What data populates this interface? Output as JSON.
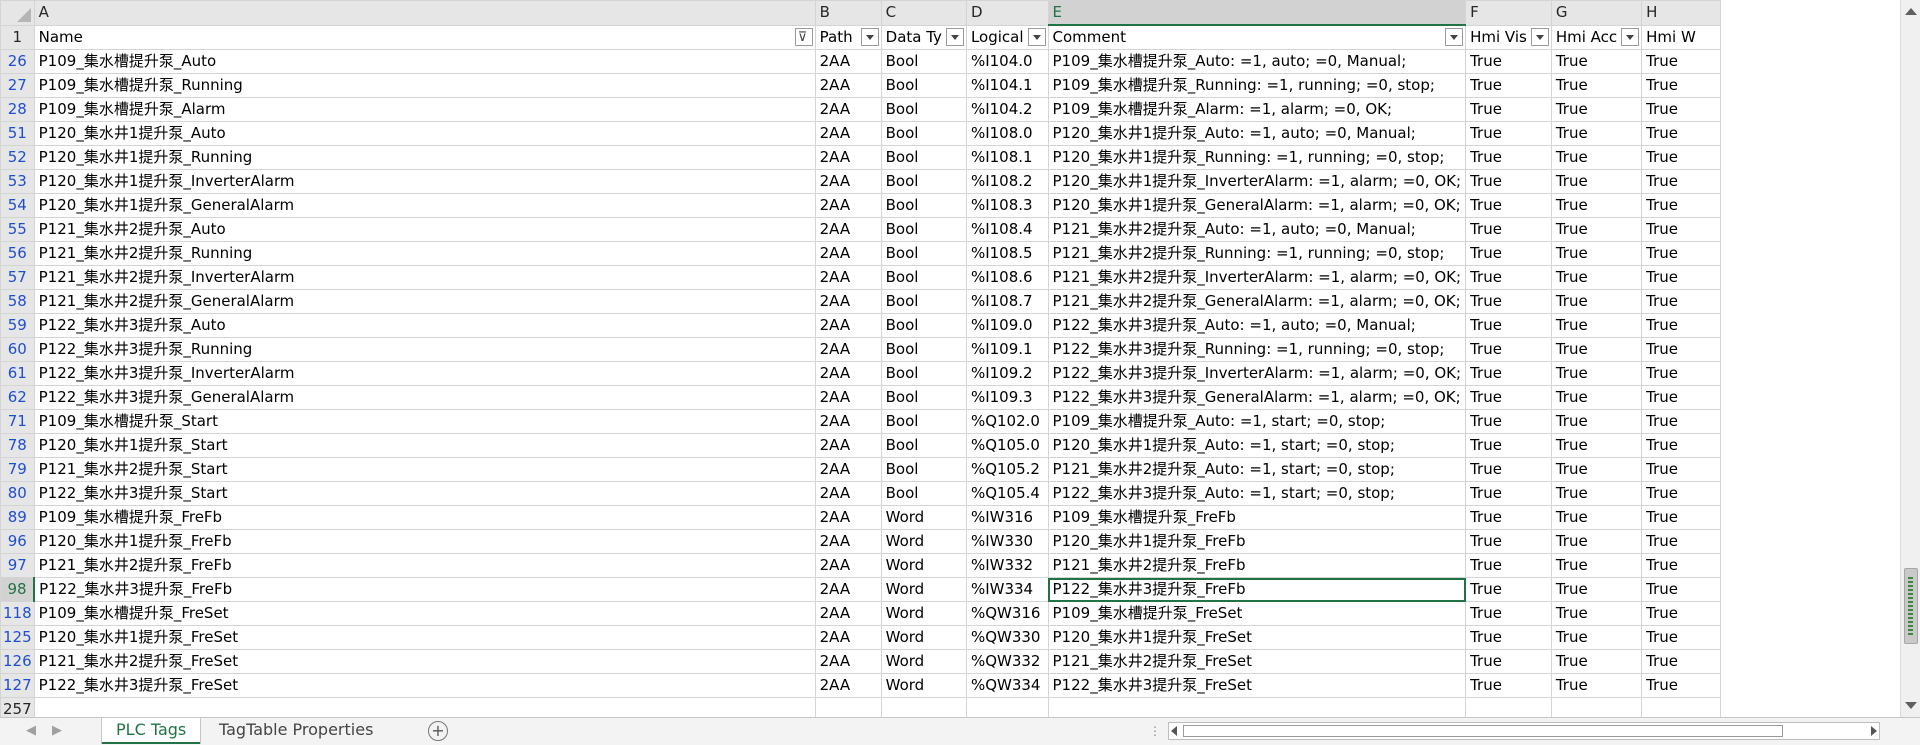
{
  "sheet": {
    "columns": [
      "A",
      "B",
      "C",
      "D",
      "E",
      "F",
      "G",
      "H"
    ],
    "header_row_number": "1",
    "headers": [
      "Name",
      "Path",
      "Data Ty",
      "Logical",
      "Comment",
      "Hmi Vis",
      "Hmi Acc",
      "Hmi W"
    ],
    "rows": [
      {
        "n": "26",
        "cells": [
          "P109_集水槽提升泵_Auto",
          "2AA",
          "Bool",
          "%I104.0",
          "P109_集水槽提升泵_Auto: =1, auto; =0, Manual;",
          "True",
          "True",
          "True"
        ]
      },
      {
        "n": "27",
        "cells": [
          "P109_集水槽提升泵_Running",
          "2AA",
          "Bool",
          "%I104.1",
          "P109_集水槽提升泵_Running: =1, running; =0, stop;",
          "True",
          "True",
          "True"
        ]
      },
      {
        "n": "28",
        "cells": [
          "P109_集水槽提升泵_Alarm",
          "2AA",
          "Bool",
          "%I104.2",
          "P109_集水槽提升泵_Alarm: =1, alarm; =0, OK;",
          "True",
          "True",
          "True"
        ]
      },
      {
        "n": "51",
        "cells": [
          "P120_集水井1提升泵_Auto",
          "2AA",
          "Bool",
          "%I108.0",
          "P120_集水井1提升泵_Auto: =1, auto; =0, Manual;",
          "True",
          "True",
          "True"
        ]
      },
      {
        "n": "52",
        "cells": [
          "P120_集水井1提升泵_Running",
          "2AA",
          "Bool",
          "%I108.1",
          "P120_集水井1提升泵_Running: =1, running; =0, stop;",
          "True",
          "True",
          "True"
        ]
      },
      {
        "n": "53",
        "cells": [
          "P120_集水井1提升泵_InverterAlarm",
          "2AA",
          "Bool",
          "%I108.2",
          "P120_集水井1提升泵_InverterAlarm: =1, alarm; =0, OK;",
          "True",
          "True",
          "True"
        ]
      },
      {
        "n": "54",
        "cells": [
          "P120_集水井1提升泵_GeneralAlarm",
          "2AA",
          "Bool",
          "%I108.3",
          "P120_集水井1提升泵_GeneralAlarm: =1, alarm; =0, OK;",
          "True",
          "True",
          "True"
        ]
      },
      {
        "n": "55",
        "cells": [
          "P121_集水井2提升泵_Auto",
          "2AA",
          "Bool",
          "%I108.4",
          "P121_集水井2提升泵_Auto: =1, auto; =0, Manual;",
          "True",
          "True",
          "True"
        ]
      },
      {
        "n": "56",
        "cells": [
          "P121_集水井2提升泵_Running",
          "2AA",
          "Bool",
          "%I108.5",
          "P121_集水井2提升泵_Running: =1, running; =0, stop;",
          "True",
          "True",
          "True"
        ]
      },
      {
        "n": "57",
        "cells": [
          "P121_集水井2提升泵_InverterAlarm",
          "2AA",
          "Bool",
          "%I108.6",
          "P121_集水井2提升泵_InverterAlarm: =1, alarm; =0, OK;",
          "True",
          "True",
          "True"
        ]
      },
      {
        "n": "58",
        "cells": [
          "P121_集水井2提升泵_GeneralAlarm",
          "2AA",
          "Bool",
          "%I108.7",
          "P121_集水井2提升泵_GeneralAlarm: =1, alarm; =0, OK;",
          "True",
          "True",
          "True"
        ]
      },
      {
        "n": "59",
        "cells": [
          "P122_集水井3提升泵_Auto",
          "2AA",
          "Bool",
          "%I109.0",
          "P122_集水井3提升泵_Auto: =1, auto; =0, Manual;",
          "True",
          "True",
          "True"
        ]
      },
      {
        "n": "60",
        "cells": [
          "P122_集水井3提升泵_Running",
          "2AA",
          "Bool",
          "%I109.1",
          "P122_集水井3提升泵_Running: =1, running; =0, stop;",
          "True",
          "True",
          "True"
        ]
      },
      {
        "n": "61",
        "cells": [
          "P122_集水井3提升泵_InverterAlarm",
          "2AA",
          "Bool",
          "%I109.2",
          "P122_集水井3提升泵_InverterAlarm: =1, alarm; =0, OK;",
          "True",
          "True",
          "True"
        ]
      },
      {
        "n": "62",
        "cells": [
          "P122_集水井3提升泵_GeneralAlarm",
          "2AA",
          "Bool",
          "%I109.3",
          "P122_集水井3提升泵_GeneralAlarm: =1, alarm; =0, OK;",
          "True",
          "True",
          "True"
        ]
      },
      {
        "n": "71",
        "cells": [
          "P109_集水槽提升泵_Start",
          "2AA",
          "Bool",
          "%Q102.0",
          "P109_集水槽提升泵_Auto: =1, start; =0, stop;",
          "True",
          "True",
          "True"
        ]
      },
      {
        "n": "78",
        "cells": [
          "P120_集水井1提升泵_Start",
          "2AA",
          "Bool",
          "%Q105.0",
          "P120_集水井1提升泵_Auto: =1, start; =0, stop;",
          "True",
          "True",
          "True"
        ]
      },
      {
        "n": "79",
        "cells": [
          "P121_集水井2提升泵_Start",
          "2AA",
          "Bool",
          "%Q105.2",
          "P121_集水井2提升泵_Auto: =1, start; =0, stop;",
          "True",
          "True",
          "True"
        ]
      },
      {
        "n": "80",
        "cells": [
          "P122_集水井3提升泵_Start",
          "2AA",
          "Bool",
          "%Q105.4",
          "P122_集水井3提升泵_Auto: =1, start; =0, stop;",
          "True",
          "True",
          "True"
        ]
      },
      {
        "n": "89",
        "cells": [
          "P109_集水槽提升泵_FreFb",
          "2AA",
          "Word",
          "%IW316",
          "P109_集水槽提升泵_FreFb",
          "True",
          "True",
          "True"
        ]
      },
      {
        "n": "96",
        "cells": [
          "P120_集水井1提升泵_FreFb",
          "2AA",
          "Word",
          "%IW330",
          "P120_集水井1提升泵_FreFb",
          "True",
          "True",
          "True"
        ]
      },
      {
        "n": "97",
        "cells": [
          "P121_集水井2提升泵_FreFb",
          "2AA",
          "Word",
          "%IW332",
          "P121_集水井2提升泵_FreFb",
          "True",
          "True",
          "True"
        ]
      },
      {
        "n": "98",
        "cells": [
          "P122_集水井3提升泵_FreFb",
          "2AA",
          "Word",
          "%IW334",
          "P122_集水井3提升泵_FreFb",
          "True",
          "True",
          "True"
        ]
      },
      {
        "n": "118",
        "cells": [
          "P109_集水槽提升泵_FreSet",
          "2AA",
          "Word",
          "%QW316",
          "P109_集水槽提升泵_FreSet",
          "True",
          "True",
          "True"
        ]
      },
      {
        "n": "125",
        "cells": [
          "P120_集水井1提升泵_FreSet",
          "2AA",
          "Word",
          "%QW330",
          "P120_集水井1提升泵_FreSet",
          "True",
          "True",
          "True"
        ]
      },
      {
        "n": "126",
        "cells": [
          "P121_集水井2提升泵_FreSet",
          "2AA",
          "Word",
          "%QW332",
          "P121_集水井2提升泵_FreSet",
          "True",
          "True",
          "True"
        ]
      },
      {
        "n": "127",
        "cells": [
          "P122_集水井3提升泵_FreSet",
          "2AA",
          "Word",
          "%QW334",
          "P122_集水井3提升泵_FreSet",
          "True",
          "True",
          "True"
        ]
      }
    ],
    "last_row_number": "257",
    "selected_row": "98",
    "selected_column": "E"
  },
  "tabs": {
    "sheets": [
      "PLC Tags",
      "TagTable Properties"
    ],
    "active": "PLC Tags"
  },
  "colors": {
    "accent": "#217346",
    "row_link": "#1f4fcf",
    "header_bg": "#e6e6e6"
  }
}
